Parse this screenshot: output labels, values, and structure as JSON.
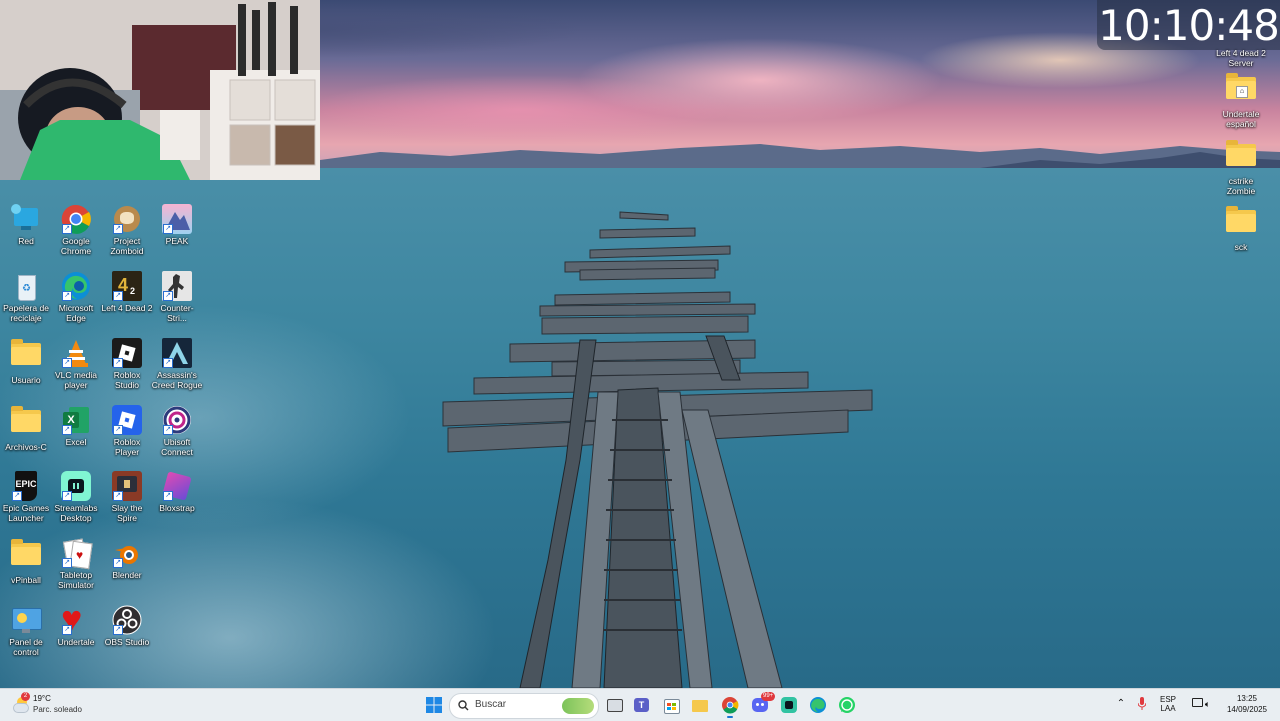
{
  "clock": {
    "time": "10:10:48"
  },
  "desktop": {
    "left_icons": [
      {
        "label": "Red",
        "icon": "network-icon"
      },
      {
        "label": "Google Chrome",
        "icon": "chrome-icon"
      },
      {
        "label": "Project Zomboid",
        "icon": "project-zomboid-icon"
      },
      {
        "label": "PEAK",
        "icon": "peak-icon"
      },
      {
        "label": "Papelera de reciclaje",
        "icon": "recycle-bin-icon"
      },
      {
        "label": "Microsoft Edge",
        "icon": "edge-icon"
      },
      {
        "label": "Left 4 Dead 2",
        "icon": "left4dead2-icon"
      },
      {
        "label": "Counter-Stri...",
        "icon": "counter-strike-icon"
      },
      {
        "label": "Usuario",
        "icon": "folder-icon"
      },
      {
        "label": "VLC media player",
        "icon": "vlc-icon"
      },
      {
        "label": "Roblox Studio",
        "icon": "roblox-studio-icon"
      },
      {
        "label": "Assassin's Creed Rogue",
        "icon": "assassins-creed-icon"
      },
      {
        "label": "Archivos-C",
        "icon": "folder-icon"
      },
      {
        "label": "Excel",
        "icon": "excel-icon"
      },
      {
        "label": "Roblox Player",
        "icon": "roblox-player-icon"
      },
      {
        "label": "Ubisoft Connect",
        "icon": "ubisoft-icon"
      },
      {
        "label": "Epic Games Launcher",
        "icon": "epic-games-icon"
      },
      {
        "label": "Streamlabs Desktop",
        "icon": "streamlabs-icon"
      },
      {
        "label": "Slay the Spire",
        "icon": "slay-the-spire-icon"
      },
      {
        "label": "Bloxstrap",
        "icon": "bloxstrap-icon"
      },
      {
        "label": "vPinball",
        "icon": "folder-icon"
      },
      {
        "label": "Tabletop Simulator",
        "icon": "tabletop-simulator-icon"
      },
      {
        "label": "Blender",
        "icon": "blender-icon"
      },
      {
        "label": "Panel de control",
        "icon": "control-panel-icon"
      },
      {
        "label": "Undertale",
        "icon": "undertale-icon"
      },
      {
        "label": "OBS Studio",
        "icon": "obs-icon"
      }
    ],
    "right_icons": [
      {
        "label": "Left 4 dead 2 Server",
        "icon": "folder-icon"
      },
      {
        "label": "Undertale español",
        "icon": "folder-icon"
      },
      {
        "label": "cstrike Zombie",
        "icon": "folder-icon"
      },
      {
        "label": "sck",
        "icon": "folder-icon"
      }
    ]
  },
  "taskbar": {
    "weather": {
      "temp": "19°C",
      "desc": "Parc. soleado",
      "badge": "2"
    },
    "search_placeholder": "Buscar",
    "pinned": [
      {
        "name": "start-button",
        "icon": "windows-icon"
      },
      {
        "name": "task-view-button",
        "icon": "task-view-icon"
      },
      {
        "name": "teams-button",
        "icon": "teams-icon"
      },
      {
        "name": "store-button",
        "icon": "store-icon"
      },
      {
        "name": "file-explorer-button",
        "icon": "folder-icon"
      },
      {
        "name": "chrome-button",
        "icon": "chrome-icon"
      },
      {
        "name": "discord-button",
        "icon": "discord-icon"
      },
      {
        "name": "streamlabs-button",
        "icon": "streamlabs-icon"
      },
      {
        "name": "edge-button",
        "icon": "edge-icon"
      },
      {
        "name": "whatsapp-button",
        "icon": "whatsapp-icon"
      }
    ],
    "discord_badge": "99+",
    "language": {
      "line1": "ESP",
      "line2": "LAA"
    },
    "time": "13:25",
    "date": "14/09/2025"
  }
}
